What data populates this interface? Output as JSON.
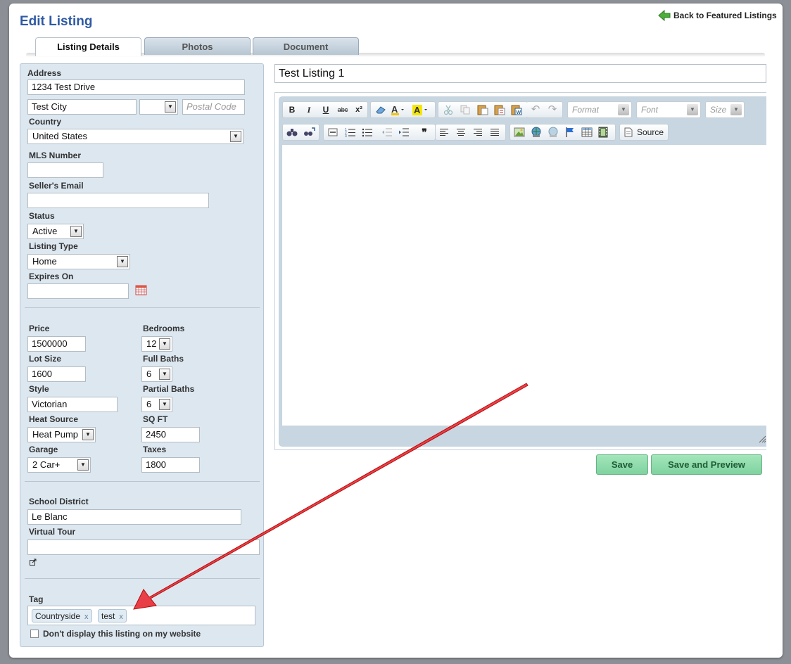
{
  "header": {
    "title": "Edit Listing",
    "back_link": "Back to Featured Listings"
  },
  "tabs": [
    {
      "label": "Listing Details",
      "active": true
    },
    {
      "label": "Photos",
      "active": false
    },
    {
      "label": "Document",
      "active": false
    }
  ],
  "form": {
    "address_label": "Address",
    "address_value": "1234 Test Drive",
    "city_value": "Test City",
    "state_value": "",
    "postal_placeholder": "Postal Code",
    "country_label": "Country",
    "country_value": "United States",
    "mls_label": "MLS Number",
    "mls_value": "",
    "seller_email_label": "Seller's Email",
    "seller_email_value": "",
    "status_label": "Status",
    "status_value": "Active",
    "listing_type_label": "Listing Type",
    "listing_type_value": "Home",
    "expires_label": "Expires On",
    "expires_value": "",
    "price_label": "Price",
    "price_value": "1500000",
    "bedrooms_label": "Bedrooms",
    "bedrooms_value": "12",
    "lot_size_label": "Lot Size",
    "lot_size_value": "1600",
    "full_baths_label": "Full Baths",
    "full_baths_value": "6",
    "style_label": "Style",
    "style_value": "Victorian",
    "partial_baths_label": "Partial Baths",
    "partial_baths_value": "6",
    "heat_source_label": "Heat Source",
    "heat_source_value": "Heat Pump",
    "sqft_label": "SQ FT",
    "sqft_value": "2450",
    "garage_label": "Garage",
    "garage_value": "2 Car+",
    "taxes_label": "Taxes",
    "taxes_value": "1800",
    "school_label": "School District",
    "school_value": "Le Blanc",
    "virtual_tour_label": "Virtual Tour",
    "virtual_tour_value": "",
    "tag_label": "Tag",
    "tags": [
      "Countryside",
      "test"
    ],
    "tag_remove": "x",
    "hide_listing_label": "Don't display this listing on my website"
  },
  "editor": {
    "title_value": "Test Listing 1",
    "format_placeholder": "Format",
    "font_placeholder": "Font",
    "size_placeholder": "Size",
    "source_label": "Source",
    "bold_glyph": "B",
    "italic_glyph": "I",
    "underline_glyph": "U",
    "strike_glyph": "abc",
    "superscript_glyph": "x²",
    "quote_glyph": "❞"
  },
  "actions": {
    "save_label": "Save",
    "save_preview_label": "Save and Preview"
  },
  "colors": {
    "title_blue": "#2f5aa3",
    "panel_bg": "#dce7f0",
    "button_green": "#8fdcab",
    "arrow_red": "#e0141e"
  },
  "icons": {
    "back": "green-left-arrow-icon",
    "calendar": "calendar-icon",
    "external_link": "external-link-icon"
  }
}
